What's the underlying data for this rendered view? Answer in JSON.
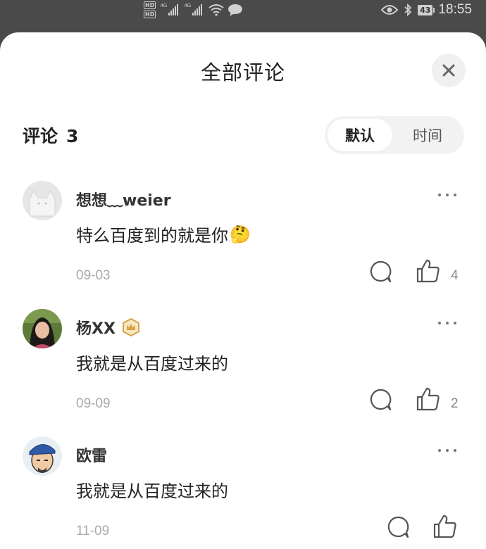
{
  "status_bar": {
    "hd1": "HD",
    "hd2": "HD",
    "net1": "4G",
    "net2": "4G",
    "battery": "43",
    "time": "18:55"
  },
  "sheet": {
    "title": "全部评论",
    "count_label": "评论",
    "count": "3",
    "sort_tabs": [
      "默认",
      "时间"
    ],
    "active_sort": "默认"
  },
  "comments": [
    {
      "name": "想想﹏weier",
      "text": "特么百度到的就是你",
      "emoji": "🤔",
      "date": "09-03",
      "likes": "4",
      "avatar": "default-cat-avatar"
    },
    {
      "name": "杨XX",
      "text": "我就是从百度过来的",
      "badge": "crown-badge-icon",
      "date": "09-09",
      "likes": "2",
      "avatar": "photo-avatar"
    },
    {
      "name": "欧雷",
      "text": "我就是从百度过来的",
      "date": "11-09",
      "likes": "",
      "avatar": "cartoon-avatar"
    }
  ],
  "colors": {
    "status_bg": "#4a4a4a",
    "sheet_bg": "#ffffff",
    "badge_gold": "#d9a441"
  }
}
